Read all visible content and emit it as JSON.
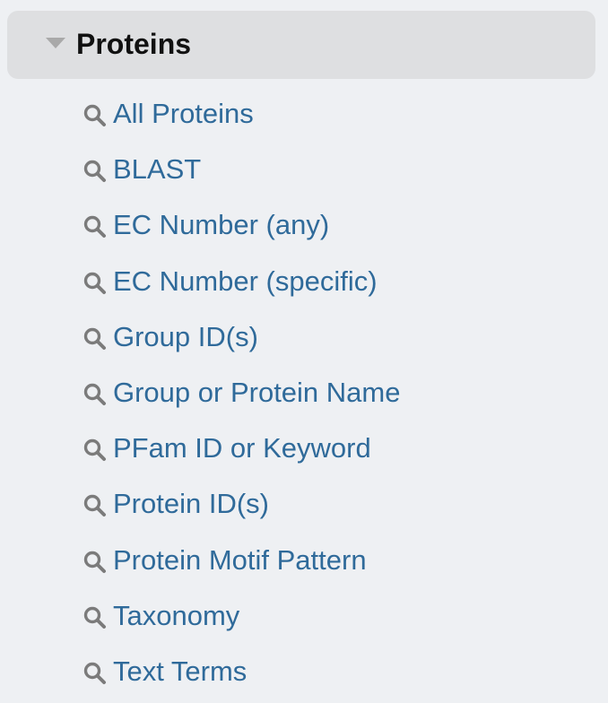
{
  "section": {
    "title": "Proteins",
    "expanded_icon": "caret-down-icon"
  },
  "items": [
    {
      "label": "All Proteins",
      "icon": "search-icon"
    },
    {
      "label": "BLAST",
      "icon": "search-icon"
    },
    {
      "label": "EC Number (any)",
      "icon": "search-icon"
    },
    {
      "label": "EC Number (specific)",
      "icon": "search-icon"
    },
    {
      "label": "Group ID(s)",
      "icon": "search-icon"
    },
    {
      "label": "Group or Protein Name",
      "icon": "search-icon"
    },
    {
      "label": "PFam ID or Keyword",
      "icon": "search-icon"
    },
    {
      "label": "Protein ID(s)",
      "icon": "search-icon"
    },
    {
      "label": "Protein Motif Pattern",
      "icon": "search-icon"
    },
    {
      "label": "Taxonomy",
      "icon": "search-icon"
    },
    {
      "label": "Text Terms",
      "icon": "search-icon"
    }
  ],
  "colors": {
    "link": "#2f6a9a",
    "icon": "#7b7b7b",
    "header_bg": "#dedfe1",
    "panel_bg": "#eef0f3"
  }
}
